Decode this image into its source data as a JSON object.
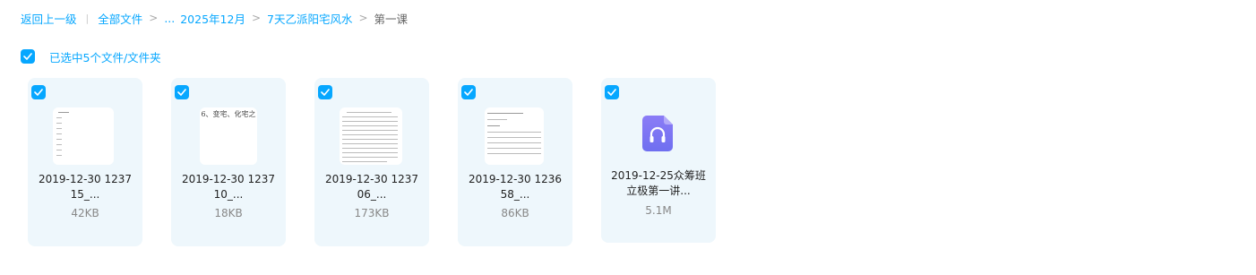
{
  "breadcrumb": {
    "back": "返回上一级",
    "all_files": "全部文件",
    "ellipsis": "...",
    "folder1": "2025年12月",
    "folder2": "7天乙派阳宅风水",
    "current": "第一课"
  },
  "selection": {
    "label": "已选中5个文件/文件夹",
    "checked": true
  },
  "accent_color": "#06a7ff",
  "files": [
    {
      "name_line1": "2019-12-30 1237",
      "name_line2": "15_...",
      "size": "42KB",
      "type": "image",
      "icon": "image-thumbnail"
    },
    {
      "name_line1": "2019-12-30 1237",
      "name_line2": "10_...",
      "size": "18KB",
      "type": "image",
      "icon": "image-thumbnail",
      "thumb_text": "6、变宅、化宅之"
    },
    {
      "name_line1": "2019-12-30 1237",
      "name_line2": "06_...",
      "size": "173KB",
      "type": "image",
      "icon": "image-thumbnail"
    },
    {
      "name_line1": "2019-12-30 1236",
      "name_line2": "58_...",
      "size": "86KB",
      "type": "image",
      "icon": "image-thumbnail"
    },
    {
      "name_line1": "2019-12-25众筹班",
      "name_line2": "立极第一讲...",
      "size": "5.1M",
      "type": "audio",
      "icon": "headphones-icon"
    }
  ]
}
